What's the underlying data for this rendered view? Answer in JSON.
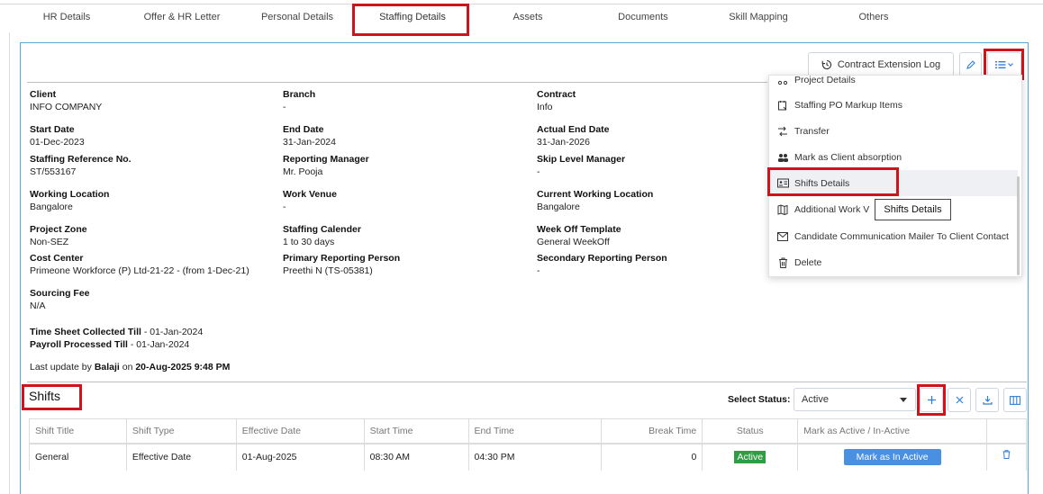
{
  "tabs": [
    "HR Details",
    "Offer & HR Letter",
    "Personal Details",
    "Staffing Details",
    "Assets",
    "Documents",
    "Skill Mapping",
    "Others"
  ],
  "toolbar": {
    "contract_log": "Contract Extension Log"
  },
  "fields": {
    "client": {
      "label": "Client",
      "value": "INFO COMPANY"
    },
    "branch": {
      "label": "Branch",
      "value": "-"
    },
    "contract": {
      "label": "Contract",
      "value": "Info"
    },
    "start_date": {
      "label": "Start Date",
      "value": "01-Dec-2023"
    },
    "end_date": {
      "label": "End Date",
      "value": "31-Jan-2024"
    },
    "actual_end_date": {
      "label": "Actual End Date",
      "value": "31-Jan-2026"
    },
    "staffing_ref": {
      "label": "Staffing Reference No.",
      "value": "ST/553167"
    },
    "reporting_manager": {
      "label": "Reporting Manager",
      "value": "Mr. Pooja"
    },
    "skip_level": {
      "label": "Skip Level Manager",
      "value": "-"
    },
    "working_location": {
      "label": "Working Location",
      "value": "Bangalore"
    },
    "work_venue": {
      "label": "Work Venue",
      "value": "-"
    },
    "current_location": {
      "label": "Current Working Location",
      "value": "Bangalore"
    },
    "project_zone": {
      "label": "Project Zone",
      "value": "Non-SEZ"
    },
    "staffing_calendar": {
      "label": "Staffing Calender",
      "value": "1 to 30 days"
    },
    "week_off": {
      "label": "Week Off Template",
      "value": "General WeekOff"
    },
    "cost_center": {
      "label": "Cost Center",
      "value": "Primeone Workforce (P) Ltd-21-22 - (from 1-Dec-21)"
    },
    "primary_reporting": {
      "label": "Primary Reporting Person",
      "value": "Preethi N (TS-05381)"
    },
    "secondary_reporting": {
      "label": "Secondary Reporting Person",
      "value": "-"
    },
    "sourcing_fee": {
      "label": "Sourcing Fee",
      "value": "N/A"
    }
  },
  "timesheet": {
    "label": "Time Sheet Collected Till",
    "value": " - 01-Jan-2024"
  },
  "payroll": {
    "label": "Payroll Processed Till",
    "value": " - 01-Jan-2024"
  },
  "last_update": {
    "prefix": "Last update by ",
    "user": "Balaji",
    "mid": " on ",
    "when": "20-Aug-2025 9:48 PM"
  },
  "menu": {
    "items": [
      {
        "label": "Project Details",
        "icon": "project-details-icon"
      },
      {
        "label": "Staffing PO Markup Items",
        "icon": "po-markup-icon"
      },
      {
        "label": "Transfer",
        "icon": "transfer-icon"
      },
      {
        "label": "Mark as Client absorption",
        "icon": "users-icon"
      },
      {
        "label": "Shifts Details",
        "icon": "id-card-icon"
      },
      {
        "label": "Additional Work V",
        "icon": "map-icon"
      },
      {
        "label": "Candidate Communication Mailer To Client Contact",
        "icon": "mail-icon"
      },
      {
        "label": "Delete",
        "icon": "trash-icon"
      }
    ],
    "tooltip": "Shifts Details"
  },
  "shifts": {
    "title": "Shifts",
    "select_label": "Select Status:",
    "select_value": "Active",
    "columns": [
      "Shift Title",
      "Shift Type",
      "Effective Date",
      "Start Time",
      "End Time",
      "Break Time",
      "Status",
      "Mark as Active / In-Active",
      ""
    ],
    "rows": [
      {
        "title": "General",
        "type": "Effective Date",
        "effective": "01-Aug-2025",
        "start": "08:30 AM",
        "end": "04:30 PM",
        "break": "0",
        "status": "Active",
        "action": "Mark as In Active"
      }
    ]
  },
  "colors": {
    "accent": "#2f7fd6",
    "highlight": "#d0121b",
    "active": "#2e9e44"
  }
}
